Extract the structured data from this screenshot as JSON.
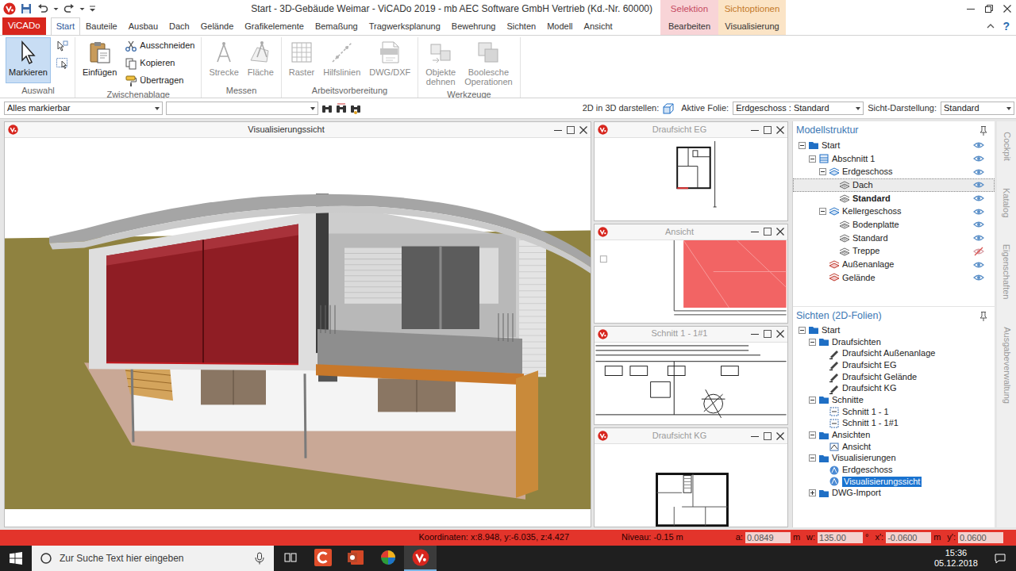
{
  "window": {
    "title": "Start - 3D-Gebäude Weimar - ViCADo 2019 - mb AEC Software GmbH Vertrieb (Kd.-Nr. 60000)"
  },
  "context_groups": [
    {
      "label": "Selektion",
      "color": "#f8d4d7",
      "tab": {
        "label": "Bearbeiten",
        "selected": false
      }
    },
    {
      "label": "Sichtoptionen",
      "color": "#fbe4c6",
      "tab": {
        "label": "Visualisierung",
        "selected": false
      }
    }
  ],
  "ribbon": {
    "app_button": "ViCADo",
    "help": "?",
    "tabs": [
      {
        "label": "Start",
        "selected": true
      },
      {
        "label": "Bauteile",
        "selected": false
      },
      {
        "label": "Ausbau",
        "selected": false
      },
      {
        "label": "Dach",
        "selected": false
      },
      {
        "label": "Gelände",
        "selected": false
      },
      {
        "label": "Grafikelemente",
        "selected": false
      },
      {
        "label": "Bemaßung",
        "selected": false
      },
      {
        "label": "Tragwerksplanung",
        "selected": false
      },
      {
        "label": "Bewehrung",
        "selected": false
      },
      {
        "label": "Sichten",
        "selected": false
      },
      {
        "label": "Modell",
        "selected": false
      },
      {
        "label": "Ansicht",
        "selected": false
      }
    ],
    "groups": [
      {
        "label": "Auswahl",
        "buttons": [
          {
            "kind": "large",
            "label": "Markieren",
            "selected": true,
            "disabled": false
          },
          {
            "kind": "icon",
            "selected": false,
            "disabled": false
          },
          {
            "kind": "icon",
            "selected": false,
            "disabled": false
          }
        ]
      },
      {
        "label": "Zwischenablage",
        "buttons": [
          {
            "kind": "large",
            "label": "Einfügen",
            "selected": false,
            "disabled": false
          },
          {
            "kind": "small",
            "label": "Ausschneiden",
            "selected": false,
            "disabled": false
          },
          {
            "kind": "small",
            "label": "Kopieren",
            "selected": false,
            "disabled": false
          },
          {
            "kind": "small",
            "label": "Übertragen",
            "selected": false,
            "disabled": false
          }
        ]
      },
      {
        "label": "Messen",
        "buttons": [
          {
            "kind": "large",
            "label": "Strecke",
            "selected": false,
            "disabled": true
          },
          {
            "kind": "large",
            "label": "Fläche",
            "selected": false,
            "disabled": true
          }
        ]
      },
      {
        "label": "Arbeitsvorbereitung",
        "buttons": [
          {
            "kind": "large",
            "label": "Raster",
            "selected": false,
            "disabled": true
          },
          {
            "kind": "large",
            "label": "Hilfslinien",
            "selected": false,
            "disabled": true
          },
          {
            "kind": "large",
            "label": "DWG/DXF",
            "selected": false,
            "disabled": true
          }
        ]
      },
      {
        "label": "Werkzeuge",
        "buttons": [
          {
            "kind": "large",
            "label": "Objekte dehnen",
            "selected": false,
            "disabled": true
          },
          {
            "kind": "large",
            "label": "Boolesche Operationen",
            "selected": false,
            "disabled": true
          }
        ]
      }
    ]
  },
  "toolbar": {
    "filter": {
      "value": "Alles markierbar"
    },
    "filter2": {
      "value": ""
    },
    "show_2d": {
      "label": "2D in 3D darstellen:"
    },
    "active_layer": {
      "label": "Aktive Folie:",
      "value": "Erdgeschoss : Standard"
    },
    "display": {
      "label": "Sicht-Darstellung:",
      "value": "Standard"
    }
  },
  "views": {
    "main": {
      "title": "Visualisierungssicht",
      "active": true
    },
    "small": [
      {
        "title": "Draufsicht EG",
        "kind": "plan-eg",
        "active": false
      },
      {
        "title": "Ansicht",
        "kind": "elevation",
        "active": false
      },
      {
        "title": "Schnitt 1 - 1#1",
        "kind": "section",
        "active": false
      },
      {
        "title": "Draufsicht KG",
        "kind": "plan-kg",
        "active": false
      }
    ]
  },
  "model_structure": {
    "title": "Modellstruktur",
    "items": [
      {
        "label": "Start",
        "kind": "folder",
        "expanded": true,
        "visible": true,
        "selected": false,
        "active": false,
        "children": [
          {
            "label": "Abschnitt 1",
            "kind": "section",
            "expanded": true,
            "visible": true,
            "selected": false,
            "active": false,
            "children": [
              {
                "label": "Erdgeschoss",
                "kind": "storey",
                "expanded": true,
                "visible": true,
                "selected": false,
                "active": false,
                "children": [
                  {
                    "label": "Dach",
                    "kind": "layer",
                    "visible": true,
                    "selected": true,
                    "active": false
                  },
                  {
                    "label": "Standard",
                    "kind": "layer",
                    "visible": true,
                    "selected": false,
                    "active": true
                  }
                ]
              },
              {
                "label": "Kellergeschoss",
                "kind": "storey",
                "expanded": true,
                "visible": true,
                "selected": false,
                "active": false,
                "children": [
                  {
                    "label": "Bodenplatte",
                    "kind": "layer",
                    "visible": true,
                    "selected": false,
                    "active": false
                  },
                  {
                    "label": "Standard",
                    "kind": "layer",
                    "visible": true,
                    "selected": false,
                    "active": false
                  },
                  {
                    "label": "Treppe",
                    "kind": "layer",
                    "visible": false,
                    "selected": false,
                    "active": false
                  }
                ]
              },
              {
                "label": "Außenanlage",
                "kind": "area",
                "visible": true,
                "selected": false,
                "active": false
              },
              {
                "label": "Gelände",
                "kind": "area",
                "visible": true,
                "selected": false,
                "active": false
              }
            ]
          }
        ]
      }
    ]
  },
  "views_tree": {
    "title": "Sichten (2D-Folien)",
    "items": [
      {
        "label": "Start",
        "kind": "folder",
        "expanded": true,
        "selected": false,
        "children": [
          {
            "label": "Draufsichten",
            "kind": "folder",
            "expanded": true,
            "selected": false,
            "children": [
              {
                "label": "Draufsicht Außenanlage",
                "kind": "plan",
                "selected": false
              },
              {
                "label": "Draufsicht EG",
                "kind": "plan",
                "selected": false
              },
              {
                "label": "Draufsicht Gelände",
                "kind": "plan",
                "selected": false
              },
              {
                "label": "Draufsicht KG",
                "kind": "plan",
                "selected": false
              }
            ]
          },
          {
            "label": "Schnitte",
            "kind": "folder",
            "expanded": true,
            "selected": false,
            "children": [
              {
                "label": "Schnitt 1 - 1",
                "kind": "cut",
                "selected": false
              },
              {
                "label": "Schnitt 1 - 1#1",
                "kind": "cut",
                "selected": false
              }
            ]
          },
          {
            "label": "Ansichten",
            "kind": "folder",
            "expanded": true,
            "selected": false,
            "children": [
              {
                "label": "Ansicht",
                "kind": "elevation",
                "selected": false
              }
            ]
          },
          {
            "label": "Visualisierungen",
            "kind": "folder",
            "expanded": true,
            "selected": false,
            "children": [
              {
                "label": "Erdgeschoss",
                "kind": "visualization",
                "selected": false
              },
              {
                "label": "Visualisierungssicht",
                "kind": "visualization",
                "selected": true
              }
            ]
          },
          {
            "label": "DWG-Import",
            "kind": "folder",
            "expanded": false,
            "selected": false
          }
        ]
      }
    ]
  },
  "side_tabs": [
    "Cockpit",
    "Katalog",
    "Eigenschaften",
    "Ausgabeverwaltung"
  ],
  "status_bar": {
    "coordinates": "Koordinaten: x:8.948, y:-6.035, z:4.427",
    "level": "Niveau: -0.15 m",
    "fields": [
      {
        "label": "a:",
        "value": "0.0849",
        "unit": "m"
      },
      {
        "label": "w:",
        "value": "135.00",
        "unit": "°"
      },
      {
        "label": "x':",
        "value": "-0.0600",
        "unit": "m"
      },
      {
        "label": "y':",
        "value": "0.0600"
      }
    ]
  },
  "taskbar": {
    "search_placeholder": "Zur Suche Text hier eingeben",
    "apps": [
      {
        "kind": "cad",
        "selected": false
      },
      {
        "kind": "powerpoint",
        "selected": false
      },
      {
        "kind": "colorful",
        "selected": false
      },
      {
        "kind": "vicado",
        "selected": true
      }
    ],
    "time": "15:36",
    "date": "05.12.2018"
  }
}
